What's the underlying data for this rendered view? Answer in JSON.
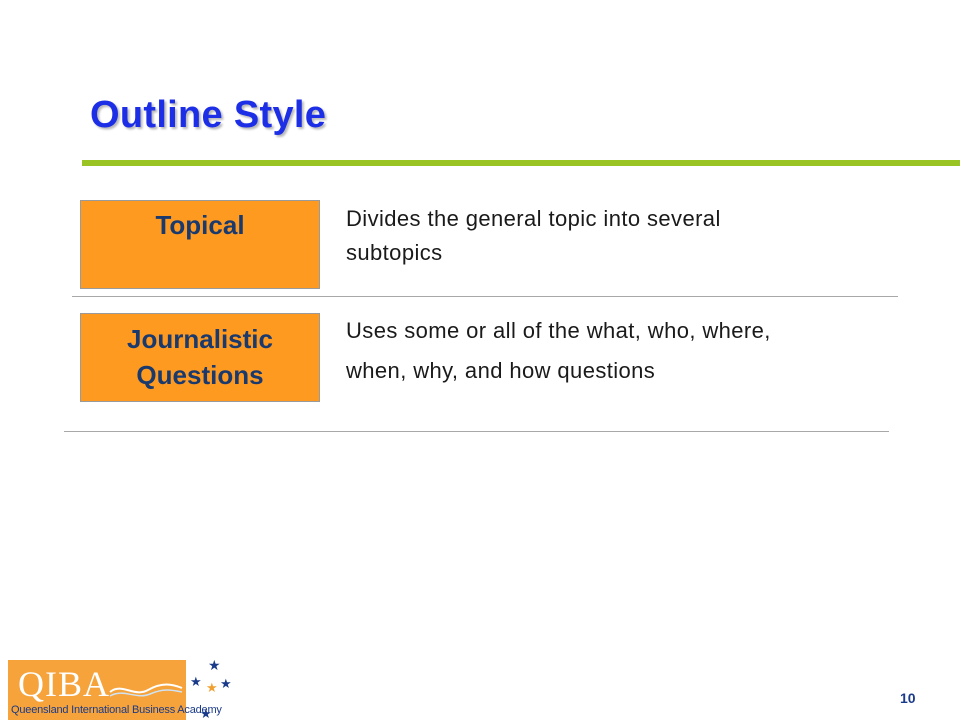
{
  "slide": {
    "title": "Outline Style",
    "page_number": "10"
  },
  "rows": [
    {
      "label_lines": [
        "Topical"
      ],
      "description_lines": [
        "Divides the general topic into several",
        "subtopics"
      ]
    },
    {
      "label_lines": [
        "Journalistic",
        "Questions"
      ],
      "description_lines": [
        "Uses some or all of the what, who, where,",
        "when, why, and how questions"
      ]
    }
  ],
  "logo": {
    "mark": "QIBA",
    "subtitle": "Queensland International Business Academy"
  },
  "colors": {
    "title": "#1c2ee6",
    "accent_rule": "#99c423",
    "box_fill": "#ff9a21",
    "box_text": "#1a3a6e",
    "logo_bg": "#f5a33a"
  }
}
